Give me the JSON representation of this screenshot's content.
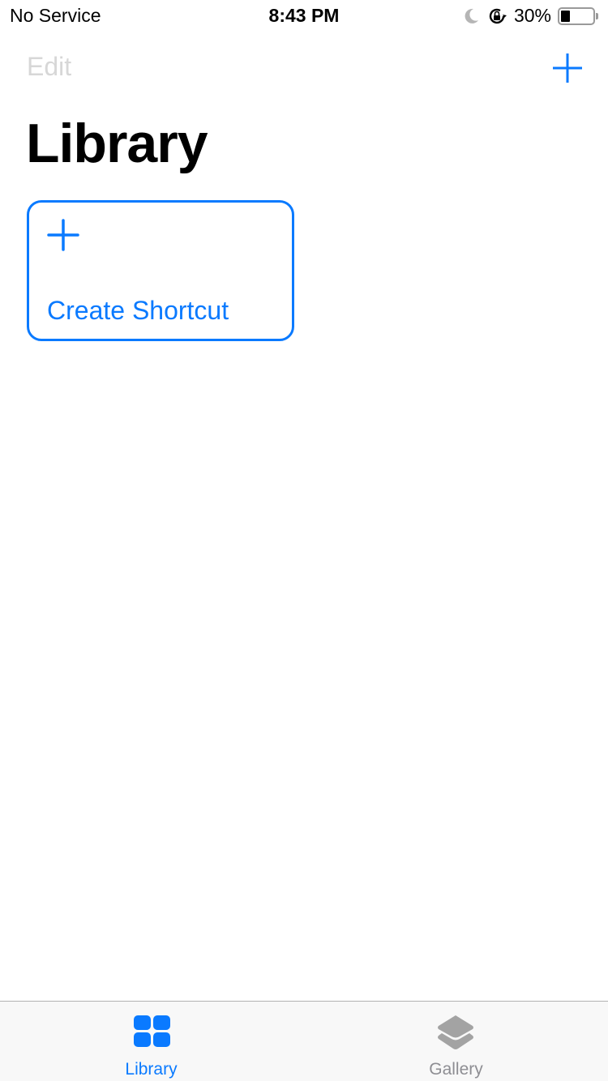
{
  "status_bar": {
    "carrier": "No Service",
    "time": "8:43 PM",
    "battery_percent_label": "30%",
    "battery_level": 0.3,
    "icons": [
      "moon-icon",
      "rotation-lock-icon",
      "battery-icon"
    ]
  },
  "nav": {
    "edit_label": "Edit",
    "add_icon": "plus-icon"
  },
  "page": {
    "title": "Library"
  },
  "create_card": {
    "icon": "plus-icon",
    "label": "Create Shortcut"
  },
  "tab_bar": {
    "tabs": [
      {
        "label": "Library",
        "icon": "grid-icon",
        "selected": true
      },
      {
        "label": "Gallery",
        "icon": "stack-icon",
        "selected": false
      }
    ]
  },
  "colors": {
    "accent": "#0A7AFF",
    "disabled_text": "#D7D7D7",
    "inactive_tab": "#8E8E93",
    "tab_bar_bg": "#F8F8F8"
  }
}
